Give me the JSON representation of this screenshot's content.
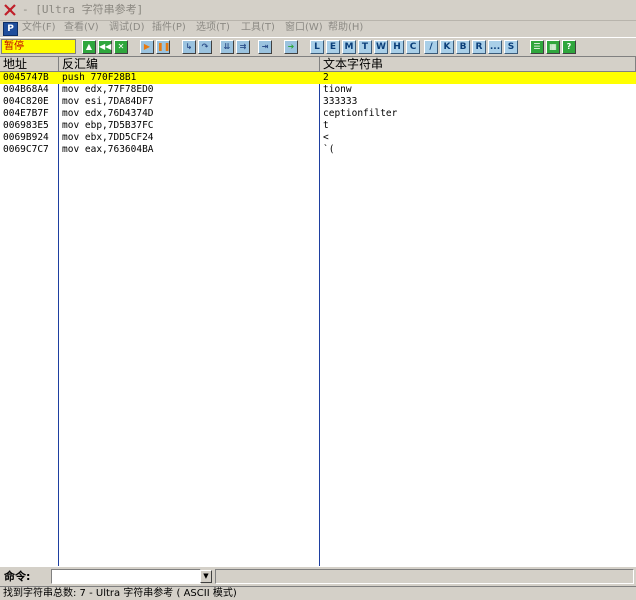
{
  "window": {
    "title": "- [Ultra 字符串参考]"
  },
  "menu": {
    "items": [
      "文件(F)",
      "查看(V)",
      "调试(D)",
      "插件(P)",
      "选项(T)",
      "工具(T)",
      "窗口(W)",
      "帮助(H)"
    ]
  },
  "toolbar": {
    "status": "暂停",
    "letters": [
      "L",
      "E",
      "M",
      "T",
      "W",
      "H",
      "C",
      "/",
      "K",
      "B",
      "R",
      "...",
      "S"
    ]
  },
  "table": {
    "columns": [
      "地址",
      "反汇编",
      "文本字符串"
    ],
    "rows": [
      {
        "address": "0045747B",
        "disasm": "push 770F28B1",
        "text": "2",
        "selected": true
      },
      {
        "address": "004B68A4",
        "disasm": "mov edx,77F78ED0",
        "text": "tionw"
      },
      {
        "address": "004C820E",
        "disasm": "mov esi,7DA84DF7",
        "text": "333333"
      },
      {
        "address": "004E7B7F",
        "disasm": "mov edx,76D4374D",
        "text": "ceptionfilter"
      },
      {
        "address": "006983E5",
        "disasm": "mov ebp,7D5B37FC",
        "text": "t"
      },
      {
        "address": "0069B924",
        "disasm": "mov ebx,7DD5CF24",
        "text": "<"
      },
      {
        "address": "0069C7C7",
        "disasm": "mov eax,763604BA",
        "text": "`("
      }
    ]
  },
  "command": {
    "label": "命令:",
    "value": ""
  },
  "statusbar": {
    "text": "找到字符串总数: 7 - Ultra 字符串参考 ( ASCII 模式)"
  },
  "colors": {
    "selection": "#ffff00",
    "status_text": "#c00000",
    "column_divider": "#1e3fa0"
  }
}
